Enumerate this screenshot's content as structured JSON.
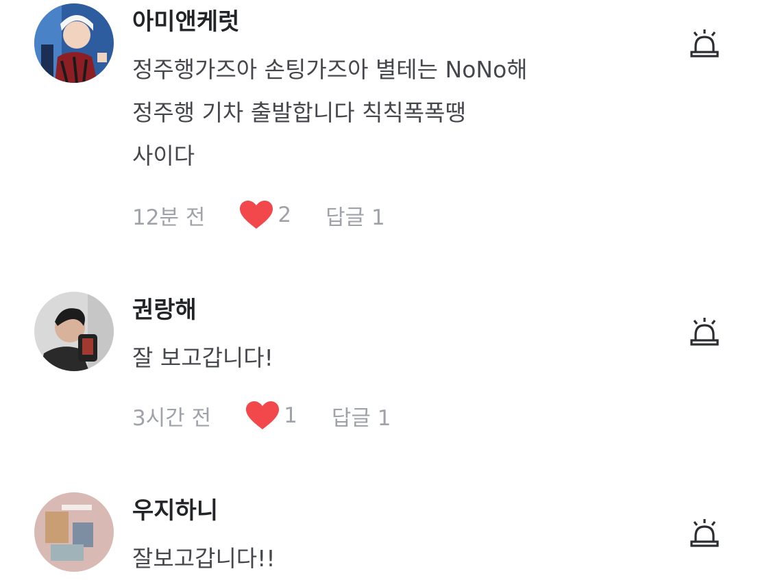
{
  "comments": [
    {
      "username": "아미앤케럿",
      "lines": [
        "정주행가즈아 손팅가즈아 별테는 NoNo해",
        "정주행 기차 출발합니다 칙칙폭폭땡",
        "사이다"
      ],
      "time": "12분 전",
      "likes": "2",
      "reply": "답글 1"
    },
    {
      "username": "권랑해",
      "lines": [
        "잘 보고갑니다!"
      ],
      "time": "3시간 전",
      "likes": "1",
      "reply": "답글 1"
    },
    {
      "username": "우지하니",
      "lines": [
        "잘보고갑니다!!"
      ]
    }
  ],
  "icons": {
    "heart": "heart-icon",
    "report": "siren-report-icon"
  },
  "colors": {
    "heart": "#f2474b",
    "meta_text": "#9fa2a8",
    "username": "#222428",
    "body_text": "#45474c"
  }
}
